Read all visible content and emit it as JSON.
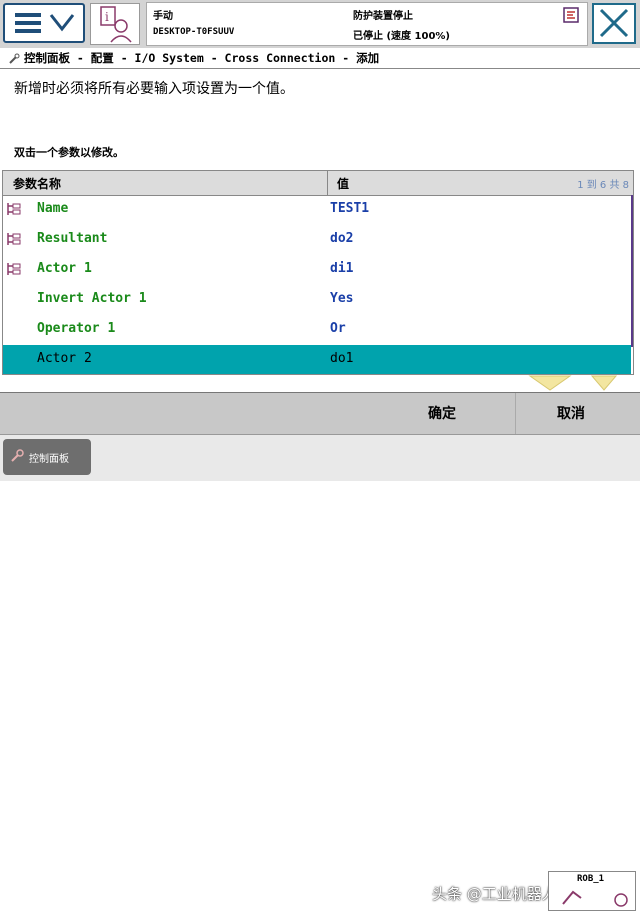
{
  "header": {
    "mode": "手动",
    "host": "DESKTOP-T0FSUUV",
    "safety": "防护装置停止",
    "run_state": "已停止 (速度 100%)"
  },
  "breadcrumb": "控制面板 - 配置 - I/O System - Cross Connection - 添加",
  "instruction": "新增时必须将所有必要输入项设置为一个值。",
  "hint": "双击一个参数以修改。",
  "table": {
    "col_name": "参数名称",
    "col_value": "值",
    "pager": "1 到 6 共 8",
    "rows": [
      {
        "name": "Name",
        "value": "TEST1",
        "required": true
      },
      {
        "name": "Resultant",
        "value": "do2",
        "required": true
      },
      {
        "name": "Actor 1",
        "value": "di1",
        "required": true
      },
      {
        "name": "Invert Actor 1",
        "value": "Yes",
        "required": false
      },
      {
        "name": "Operator 1",
        "value": "Or",
        "required": false
      },
      {
        "name": "Actor 2",
        "value": "do1",
        "required": false,
        "selected": true
      }
    ]
  },
  "buttons": {
    "ok": "确定",
    "cancel": "取消"
  },
  "taskbar": {
    "control_panel": "控制面板",
    "rob": "ROB_1"
  },
  "watermark": "头条 @工业机器人虚拟调试",
  "colors": {
    "selected_row": "#00a3ad",
    "param_name": "#1a8a1a",
    "param_value": "#1a3fa8"
  }
}
